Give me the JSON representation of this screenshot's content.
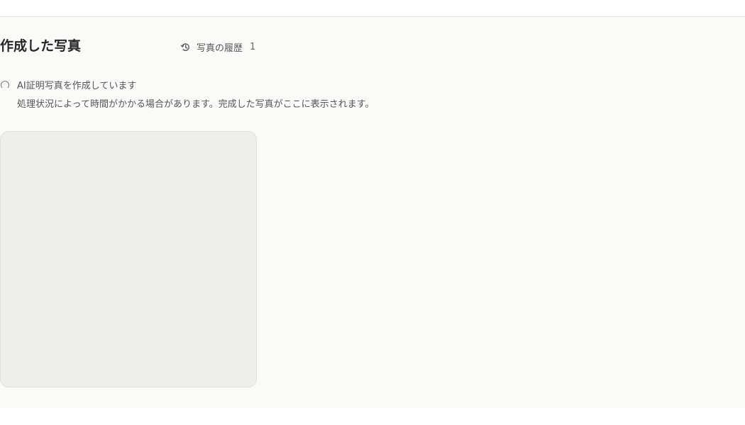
{
  "header": {
    "title": "作成した写真"
  },
  "history": {
    "icon": "history-icon",
    "label": "写真の履歴",
    "count": "1"
  },
  "status": {
    "icon": "spinner-icon",
    "title": "AI証明写真を作成しています",
    "message": "処理状況によって時間がかかる場合があります。完成した写真がここに表示されます。"
  },
  "colors": {
    "panel_background": "#fafaf9",
    "placeholder_background": "#eeefed",
    "text_primary": "#262626",
    "text_secondary": "#555555"
  }
}
